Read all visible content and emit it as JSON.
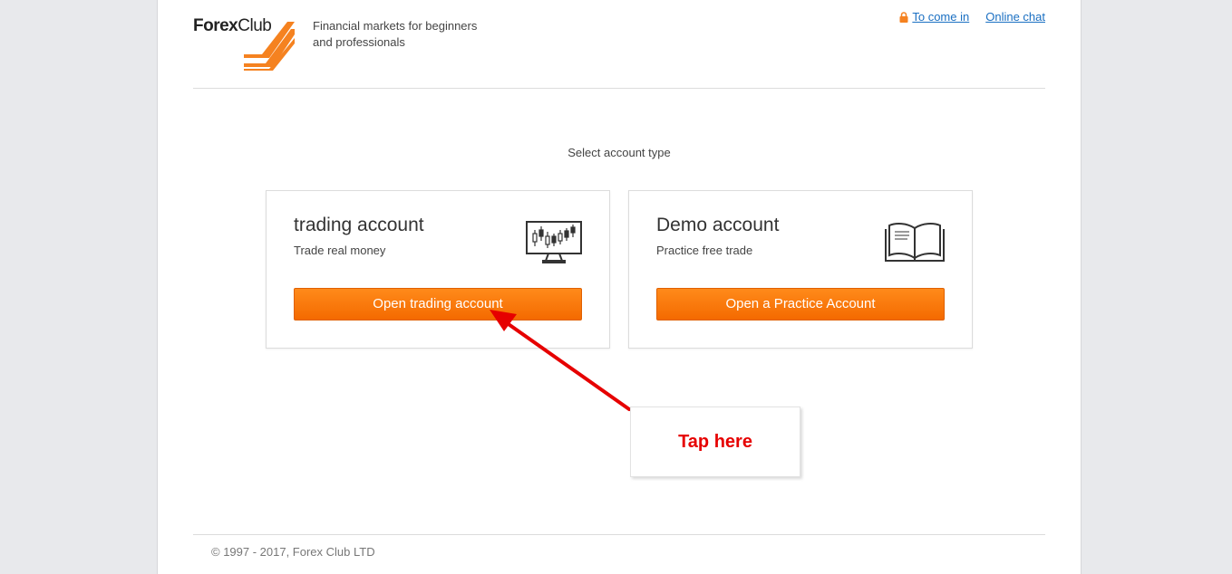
{
  "header": {
    "logo_forex": "Forex",
    "logo_club": "Club",
    "tagline": "Financial markets for beginners and professionals",
    "login_label": "To come in",
    "chat_label": "Online chat"
  },
  "main": {
    "select_title": "Select account type",
    "cards": [
      {
        "title": "trading account",
        "subtitle": "Trade real money",
        "button": "Open trading account",
        "icon": "candlestick-monitor-icon"
      },
      {
        "title": "Demo account",
        "subtitle": "Practice free trade",
        "button": "Open a Practice Account",
        "icon": "open-book-icon"
      }
    ]
  },
  "footer": {
    "copyright": "© 1997 - 2017, Forex Club LTD"
  },
  "annotation": {
    "label": "Tap here"
  },
  "colors": {
    "accent": "#f46a00",
    "link": "#1a6fc2",
    "annotation": "#e60000"
  }
}
